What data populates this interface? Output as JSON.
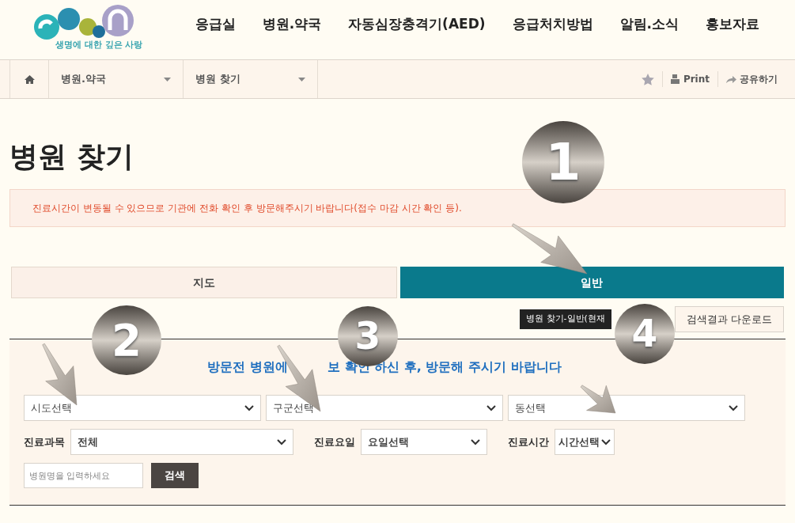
{
  "logo": {
    "tagline": "생명에 대한 깊은 사랑"
  },
  "nav": [
    "응급실",
    "병원.약국",
    "자동심장충격기(AED)",
    "응급처치방법",
    "알림.소식",
    "홍보자료"
  ],
  "breadcrumb": {
    "items": [
      "병원.약국",
      "병원 찾기"
    ]
  },
  "page_actions": [
    "Print",
    "공유하기"
  ],
  "title": "병원 찾기",
  "warning": "진료시간이 변동될 수 있으므로 기관에 전화 확인 후 방문해주시기 바랍니다(접수 마감 시간 확인 등).",
  "tabs": [
    {
      "label": "지도",
      "selected": false
    },
    {
      "label": "일반",
      "selected": true
    }
  ],
  "tooltip": "병원 찾기-일반(현재",
  "download_button": "검색결과 다운로드",
  "search": {
    "notice_parts": [
      "방문전 병원에",
      "보 확인 하신 후, 방문해 주시기 바랍니다"
    ],
    "region_selects": [
      "시도선택",
      "구군선택",
      "동선택"
    ],
    "filters": [
      {
        "label": "진료과목",
        "value": "전체"
      },
      {
        "label": "진료요일",
        "value": "요일선택"
      },
      {
        "label": "진료시간",
        "value": "시간선택"
      }
    ],
    "name_input": {
      "placeholder": "병원명을 입력하세요"
    },
    "submit": "검색"
  },
  "annotations": [
    "1",
    "2",
    "3",
    "4"
  ]
}
